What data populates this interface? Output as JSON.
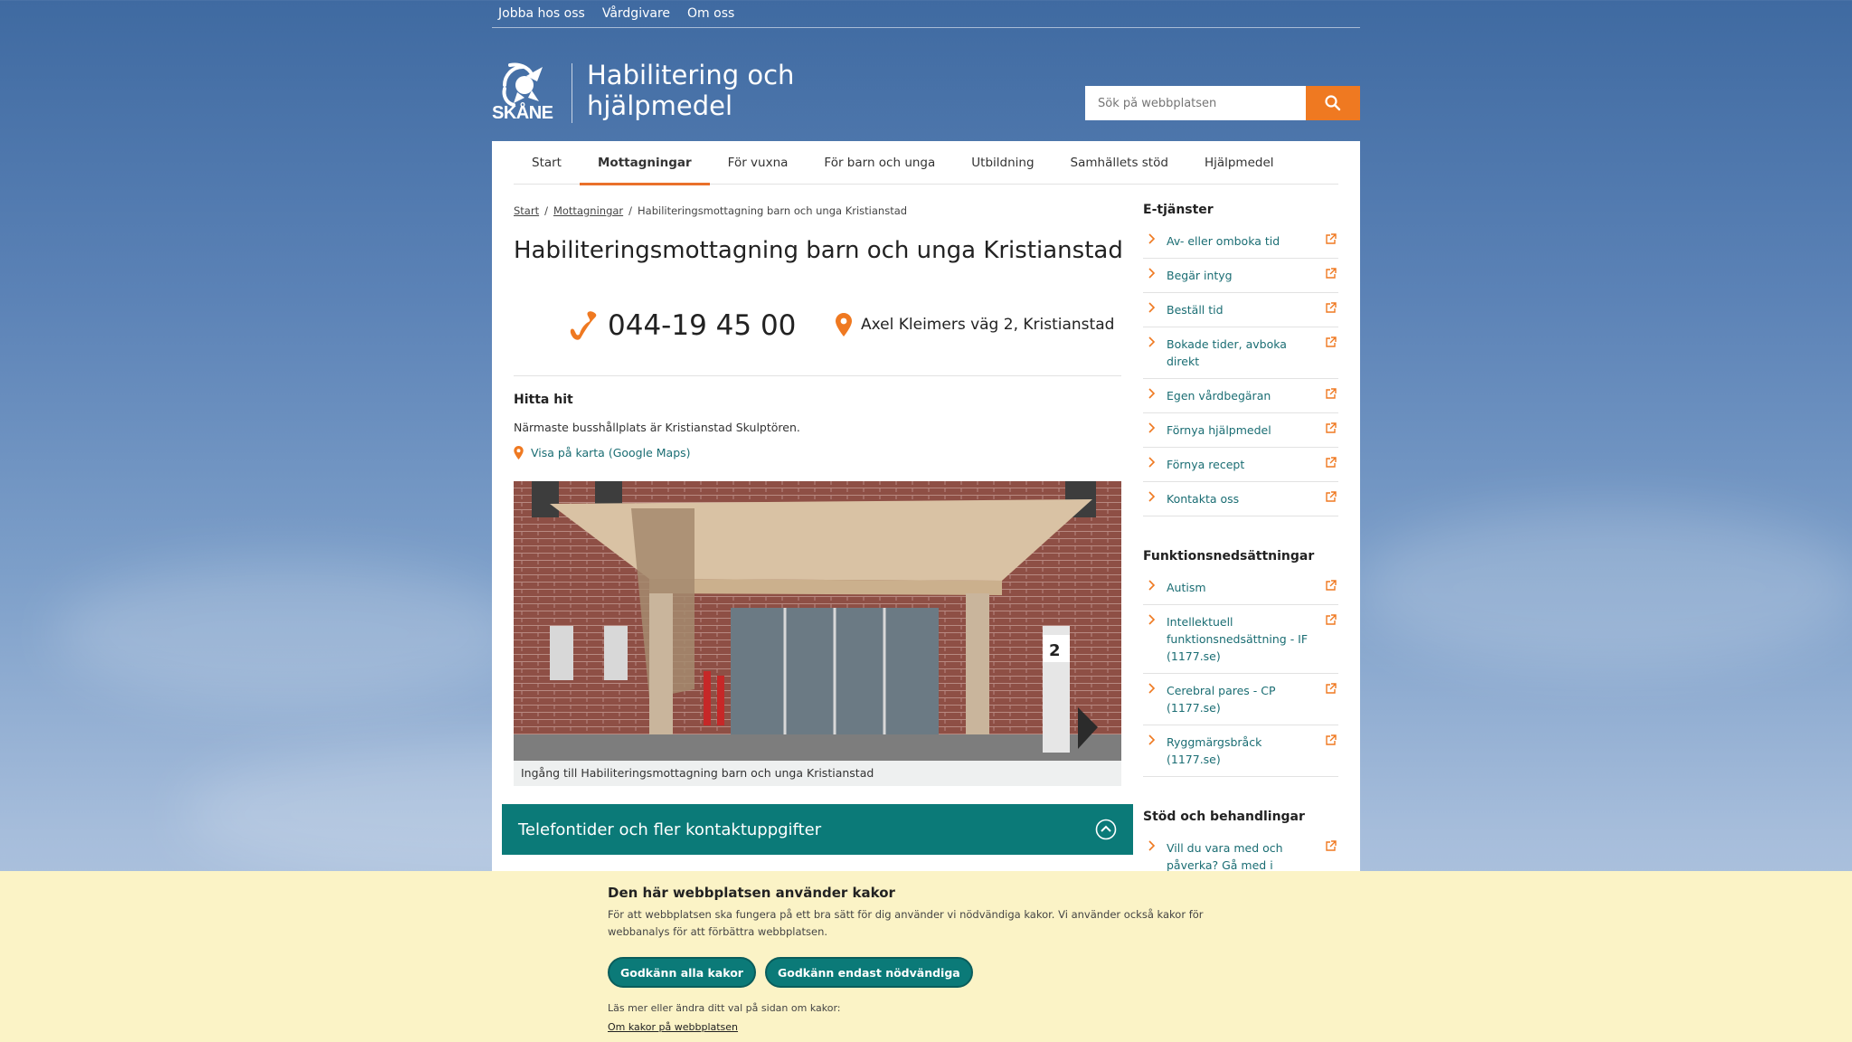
{
  "top_links": [
    "Jobba hos oss",
    "Vårdgivare",
    "Om oss"
  ],
  "header": {
    "logo_text": "SKÅNE",
    "site_title": "Habilitering och hjälpmedel",
    "search_placeholder": "Sök på webbplatsen"
  },
  "nav": {
    "items": [
      "Start",
      "Mottagningar",
      "För vuxna",
      "För barn och unga",
      "Utbildning",
      "Samhällets stöd",
      "Hjälpmedel"
    ],
    "active": "Mottagningar"
  },
  "breadcrumb": [
    "Start",
    "Mottagningar",
    "Habiliteringsmottagning barn och unga Kristianstad"
  ],
  "page_title": "Habiliteringsmottagning barn och unga Kristianstad",
  "contact": {
    "phone": "044-19 45 00",
    "address": "Axel Kleimers väg 2, Kristianstad"
  },
  "directions": {
    "title": "Hitta hit",
    "text": "Närmaste busshållplats är Kristianstad Skulptören.",
    "map_link": "Visa på karta (Google Maps)"
  },
  "photo": {
    "caption": "Ingång till Habiliteringsmottagning barn och unga Kristianstad",
    "sign_number": "2"
  },
  "accordion": {
    "label": "Telefontider och fler kontaktuppgifter"
  },
  "sidebar": {
    "sections": [
      {
        "title": "E-tjänster",
        "items": [
          "Av- eller omboka tid",
          "Begär intyg",
          "Beställ tid",
          "Bokade tider, avboka direkt",
          "Egen vårdbegäran",
          "Förnya hjälpmedel",
          "Förnya recept",
          "Kontakta oss"
        ]
      },
      {
        "title": "Funktionsnedsättningar",
        "items": [
          "Autism",
          "Intellektuell funktionsnedsättning - IF (1177.se)",
          "Cerebral pares - CP (1177.se)",
          "Ryggmärgsbråck (1177.se)"
        ]
      },
      {
        "title": "Stöd och behandlingar",
        "items": [
          "Vill du vara med och påverka? Gå med i"
        ]
      }
    ]
  },
  "cookie_banner": {
    "title": "Den här webbplatsen använder kakor",
    "description": "För att webbplatsen ska fungera på ett bra sätt för dig använder vi nödvändiga kakor. Vi använder också kakor för webbanalys för att förbättra webbplatsen.",
    "accept_all": "Godkänn alla kakor",
    "accept_necessary": "Godkänn endast nödvändiga",
    "more_text": "Läs mer eller ändra ditt val på sidan om kakor:",
    "more_link": "Om kakor på webbplatsen"
  },
  "colors": {
    "accent_orange": "#ef7921",
    "teal": "#0b7a78",
    "link": "#1a6d73",
    "cookie_bg": "#fbf3c6"
  }
}
